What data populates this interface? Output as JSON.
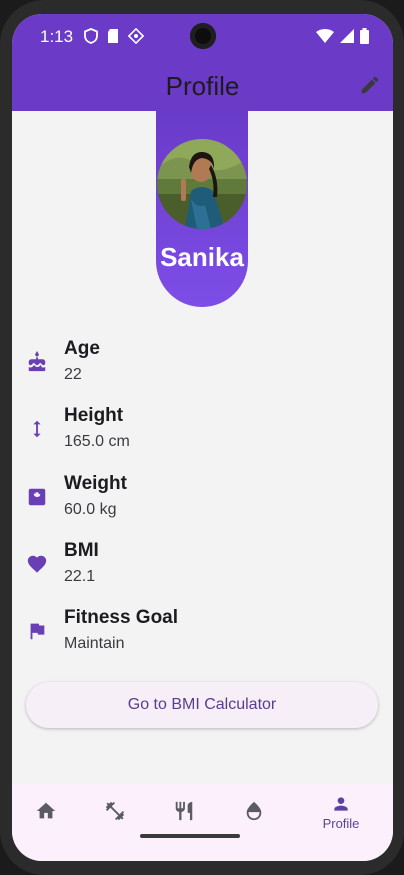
{
  "status_bar": {
    "time": "1:13"
  },
  "app_bar": {
    "title": "Profile"
  },
  "profile": {
    "name": "Sanika"
  },
  "info": [
    {
      "label": "Age",
      "value": "22",
      "icon": "cake-icon"
    },
    {
      "label": "Height",
      "value": "165.0 cm",
      "icon": "height-icon"
    },
    {
      "label": "Weight",
      "value": "60.0 kg",
      "icon": "scale-icon"
    },
    {
      "label": "BMI",
      "value": "22.1",
      "icon": "heart-icon"
    },
    {
      "label": "Fitness Goal",
      "value": "Maintain",
      "icon": "flag-icon"
    }
  ],
  "actions": {
    "bmi_button": "Go to BMI Calculator"
  },
  "bottom_nav": {
    "items": [
      {
        "icon": "home-icon",
        "label": ""
      },
      {
        "icon": "fitness-icon",
        "label": ""
      },
      {
        "icon": "restaurant-icon",
        "label": ""
      },
      {
        "icon": "water-drop-icon",
        "label": ""
      },
      {
        "icon": "person-icon",
        "label": "Profile",
        "selected": true
      }
    ]
  },
  "colors": {
    "primary": "#6b3ac6",
    "accent_icon": "#6a3fb5",
    "background": "#f3f3f3"
  }
}
